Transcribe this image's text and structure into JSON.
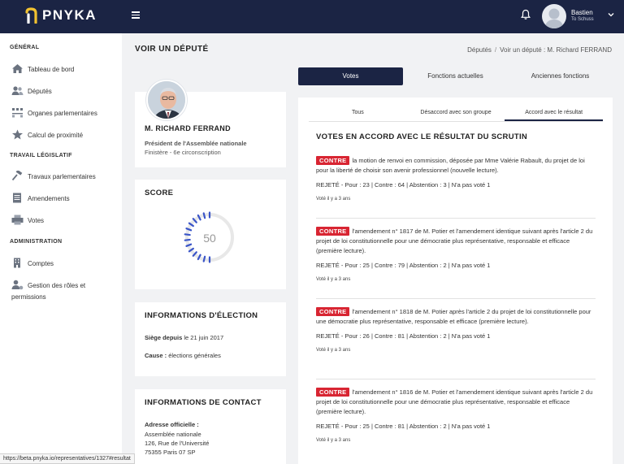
{
  "app": {
    "name": "PNYKA"
  },
  "user": {
    "name": "Bastien",
    "sub": "To Schuss"
  },
  "sidebar": {
    "sections": [
      {
        "label": "GÉNÉRAL"
      },
      {
        "label": "TRAVAIL LÉGISLATIF"
      },
      {
        "label": "ADMINISTRATION"
      }
    ],
    "items": [
      {
        "label": "Tableau de bord",
        "icon": "home-icon"
      },
      {
        "label": "Députés",
        "icon": "people-icon"
      },
      {
        "label": "Organes parlementaires",
        "icon": "org-icon"
      },
      {
        "label": "Calcul de proximité",
        "icon": "star-icon"
      },
      {
        "label": "Travaux parlementaires",
        "icon": "gavel-icon"
      },
      {
        "label": "Amendements",
        "icon": "document-icon"
      },
      {
        "label": "Votes",
        "icon": "printer-icon"
      },
      {
        "label": "Comptes",
        "icon": "building-icon"
      },
      {
        "label": "Gestion des rôles et",
        "label2": "permissions",
        "icon": "user-gear-icon"
      }
    ]
  },
  "page": {
    "title": "VOIR UN DÉPUTÉ",
    "breadcrumb": [
      "Députés",
      "Voir un député : M. Richard FERRAND"
    ]
  },
  "deputy": {
    "name": "M. RICHARD FERRAND",
    "role": "Président de l'Assemblée nationale",
    "district": "Finistère - 6e circonscription"
  },
  "score": {
    "title": "SCORE",
    "value": "50",
    "fraction": 0.5
  },
  "election": {
    "title": "INFORMATIONS D'ÉLECTION",
    "since_label": "Siège depuis",
    "since_value": "le 21 juin 2017",
    "cause_label": "Cause :",
    "cause_value": "élections générales"
  },
  "contact": {
    "title": "INFORMATIONS DE CONTACT",
    "address_label": "Adresse officielle :",
    "address_lines": [
      "Assemblée nationale",
      "126, Rue de l'Université",
      "75355 Paris 07 SP"
    ]
  },
  "tabs": [
    "Votes",
    "Fonctions actuelles",
    "Anciennes fonctions"
  ],
  "subtabs": [
    "Tous",
    "Désaccord avec son groupe",
    "Accord avec le résultat"
  ],
  "votes_heading": "VOTES EN ACCORD AVEC LE RÉSULTAT DU SCRUTIN",
  "votes": [
    {
      "badge": "CONTRE",
      "text": "la motion de renvoi en commission, déposée par Mme Valérie Rabault, du projet de loi pour la liberté de choisir son avenir professionnel (nouvelle lecture).",
      "result": "REJETÉ - Pour : 23 | Contre : 64 | Abstention : 3 | N'a pas voté 1",
      "when": "Voté il y a 3 ans"
    },
    {
      "badge": "CONTRE",
      "text": "l'amendement n° 1817 de M. Potier et l'amendement identique suivant après l'article 2 du projet de loi constitutionnelle pour une démocratie plus représentative, responsable et efficace (première lecture).",
      "result": "REJETÉ - Pour : 25 | Contre : 79 | Abstention : 2 | N'a pas voté 1",
      "when": "Voté il y a 3 ans"
    },
    {
      "badge": "CONTRE",
      "text": "l'amendement n° 1818 de M. Potier après l'article 2 du projet de loi constitutionnelle pour une démocratie plus représentative, responsable et efficace (première lecture).",
      "result": "REJETÉ - Pour : 26 | Contre : 81 | Abstention : 2 | N'a pas voté 1",
      "when": "Voté il y a 3 ans"
    },
    {
      "badge": "CONTRE",
      "text": "l'amendement n° 1816 de M. Potier et l'amendement identique suivant après l'article 2 du projet de loi constitutionnelle pour une démocratie plus représentative, responsable et efficace (première lecture).",
      "result": "REJETÉ - Pour : 25 | Contre : 81 | Abstention : 2 | N'a pas voté 1",
      "when": "Voté il y a 3 ans"
    }
  ],
  "status_url": "https://beta.pnyka.io/representatives/1327#resultat",
  "colors": {
    "navy": "#1b2444",
    "accent_red": "#d82532",
    "gauge_blue": "#3a55c8",
    "gauge_track": "#e8e8e8"
  }
}
